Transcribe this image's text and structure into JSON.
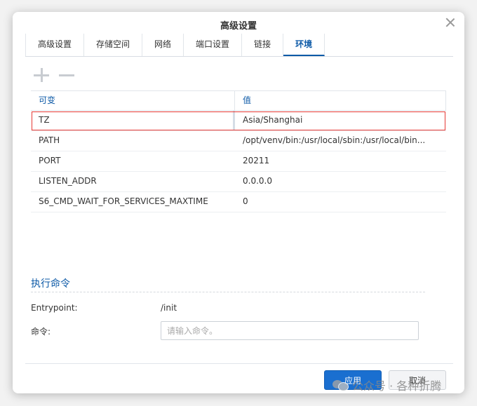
{
  "dialog": {
    "title": "高级设置"
  },
  "tabs": [
    {
      "label": "高级设置"
    },
    {
      "label": "存储空间"
    },
    {
      "label": "网络"
    },
    {
      "label": "端口设置"
    },
    {
      "label": "链接"
    },
    {
      "label": "环境",
      "active": true
    }
  ],
  "grid": {
    "headers": [
      "可变",
      "值"
    ],
    "rows": [
      {
        "name": "TZ",
        "value": "Asia/Shanghai"
      },
      {
        "name": "PATH",
        "value": "/opt/venv/bin:/usr/local/sbin:/usr/local/bin..."
      },
      {
        "name": "PORT",
        "value": "20211"
      },
      {
        "name": "LISTEN_ADDR",
        "value": "0.0.0.0"
      },
      {
        "name": "S6_CMD_WAIT_FOR_SERVICES_MAXTIME",
        "value": "0"
      }
    ]
  },
  "exec": {
    "section_title": "执行命令",
    "entrypoint_label": "Entrypoint:",
    "entrypoint_value": "/init",
    "command_label": "命令:",
    "command_placeholder": "请输入命令。"
  },
  "buttons": {
    "apply": "应用",
    "cancel": "取消"
  },
  "watermark": {
    "text": "公众号 · 各种折腾"
  },
  "colors": {
    "accent": "#0d5aa7",
    "primary_button": "#1a6fd0",
    "highlight": "#e53935"
  }
}
